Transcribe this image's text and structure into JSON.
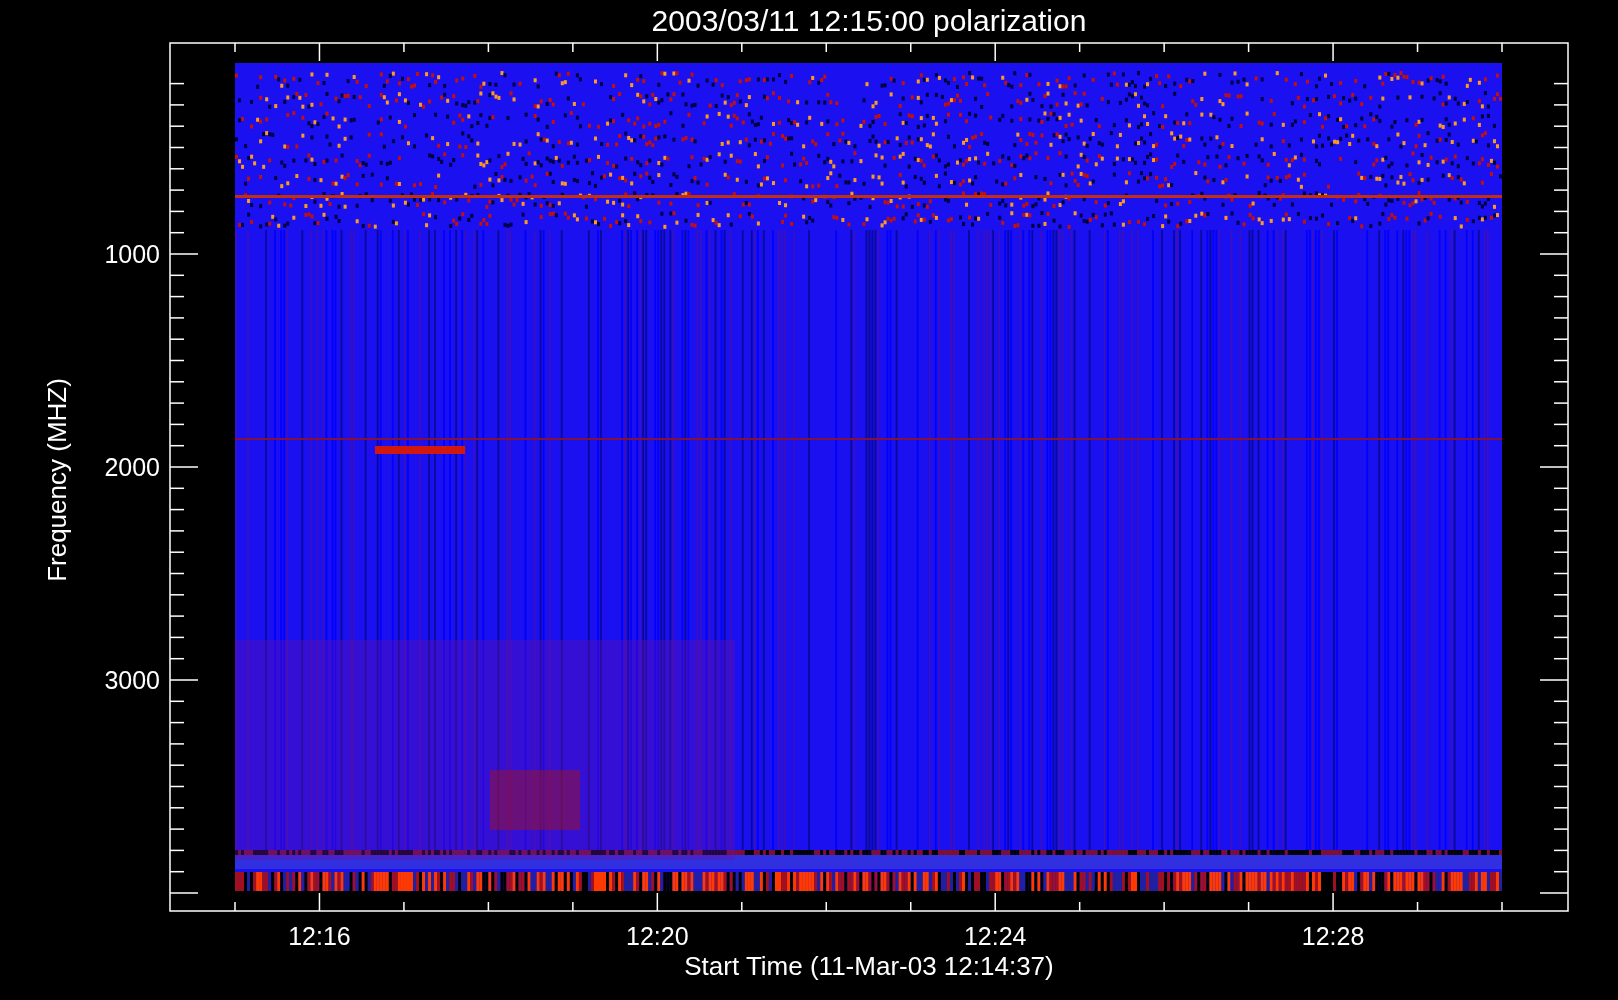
{
  "title": "2003/03/11 12:15:00 polarization",
  "y_axis": {
    "label": "Frequency (MHZ)",
    "ticks": [
      "1000",
      "2000",
      "3000"
    ]
  },
  "x_axis": {
    "label": "Start Time (11-Mar-03 12:14:37)",
    "ticks": [
      "12:16",
      "12:20",
      "12:24",
      "12:28"
    ]
  }
}
